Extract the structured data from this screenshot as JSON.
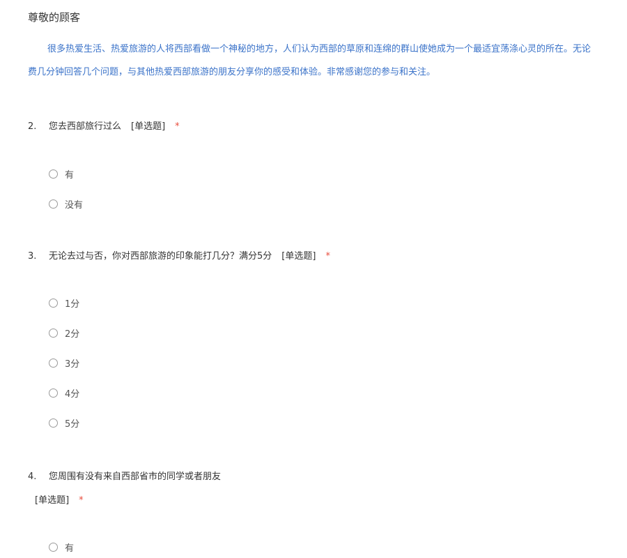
{
  "header": {
    "greeting": "尊敬的顾客",
    "intro_line1": "很多热爱生活、热爱旅游的人将西部看做一个神秘的地方，人们认为西部的草原和连绵的群山使她成为一个最适宜荡涤心灵的所在。无论",
    "intro_line2": "费几分钟回答几个问题，与其他热爱西部旅游的朋友分享你的感受和体验。非常感谢您的参与和关注。"
  },
  "questions": [
    {
      "number": "2.",
      "text": "您去西部旅行过么",
      "type_label": "[单选题]",
      "required_mark": "*",
      "options": [
        "有",
        "没有"
      ]
    },
    {
      "number": "3.",
      "text": "无论去过与否，你对西部旅游的印象能打几分？满分5分",
      "type_label": "[单选题]",
      "required_mark": "*",
      "options": [
        "1分",
        "2分",
        "3分",
        "4分",
        "5分"
      ]
    },
    {
      "number": "4.",
      "text": "您周围有没有来自西部省市的同学或者朋友",
      "type_label": "[单选题]",
      "required_mark": "*",
      "options": [
        "有"
      ]
    }
  ],
  "colors": {
    "intro_text": "#3b73c9",
    "required": "#e84c3d",
    "body_text": "#333333"
  }
}
